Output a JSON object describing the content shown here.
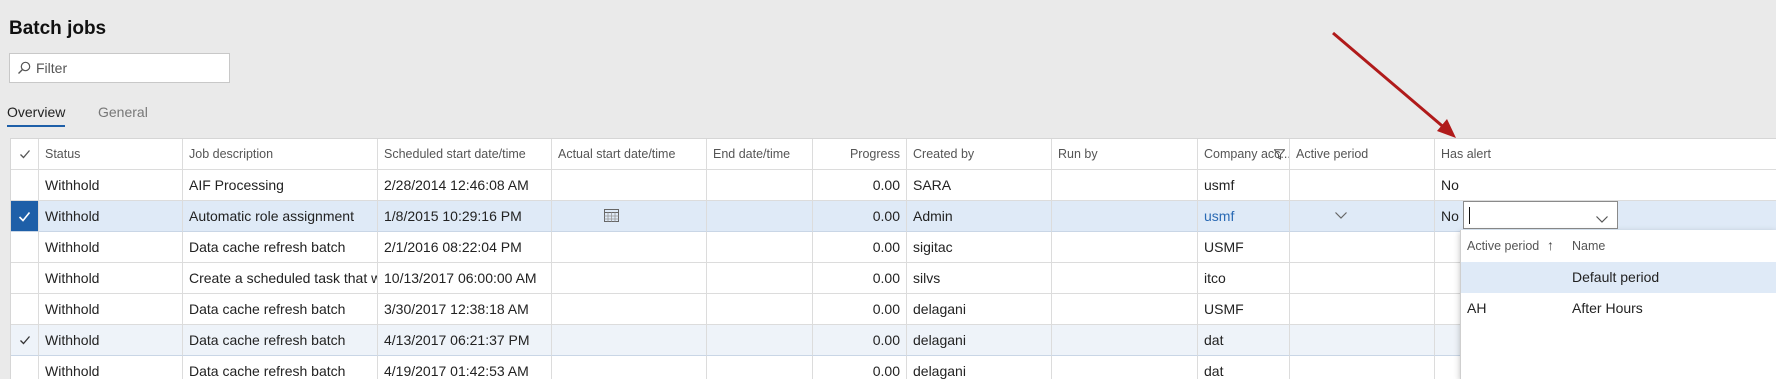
{
  "page": {
    "title": "Batch jobs"
  },
  "filter": {
    "placeholder": "Filter"
  },
  "tabs": [
    {
      "label": "Overview"
    },
    {
      "label": "General"
    }
  ],
  "grid": {
    "columns": [
      "Status",
      "Job description",
      "Scheduled start date/time",
      "Actual start date/time",
      "End date/time",
      "Progress",
      "Created by",
      "Run by",
      "Company acc...",
      "Active period",
      "Has alert"
    ],
    "rows": [
      {
        "status": "Withhold",
        "description": "AIF Processing",
        "scheduled": "2/28/2014 12:46:08 AM",
        "actual": "",
        "end": "",
        "progress": "0.00",
        "created_by": "SARA",
        "run_by": "",
        "company": "usmf",
        "active_period": "",
        "has_alert": "No"
      },
      {
        "status": "Withhold",
        "description": "Automatic role assignment",
        "scheduled": "1/8/2015 10:29:16 PM",
        "actual": "",
        "end": "",
        "progress": "0.00",
        "created_by": "Admin",
        "run_by": "",
        "company": "usmf",
        "active_period": "",
        "has_alert": "No"
      },
      {
        "status": "Withhold",
        "description": "Data cache refresh batch",
        "scheduled": "2/1/2016 08:22:04 PM",
        "actual": "",
        "end": "",
        "progress": "0.00",
        "created_by": "sigitac",
        "run_by": "",
        "company": "USMF",
        "active_period": "",
        "has_alert": ""
      },
      {
        "status": "Withhold",
        "description": "Create a scheduled task that will...",
        "scheduled": "10/13/2017 06:00:00 AM",
        "actual": "",
        "end": "",
        "progress": "0.00",
        "created_by": "silvs",
        "run_by": "",
        "company": "itco",
        "active_period": "",
        "has_alert": ""
      },
      {
        "status": "Withhold",
        "description": "Data cache refresh batch",
        "scheduled": "3/30/2017 12:38:18 AM",
        "actual": "",
        "end": "",
        "progress": "0.00",
        "created_by": "delagani",
        "run_by": "",
        "company": "USMF",
        "active_period": "",
        "has_alert": ""
      },
      {
        "status": "Withhold",
        "description": "Data cache refresh batch",
        "scheduled": "4/13/2017 06:21:37 PM",
        "actual": "",
        "end": "",
        "progress": "0.00",
        "created_by": "delagani",
        "run_by": "",
        "company": "dat",
        "active_period": "",
        "has_alert": ""
      },
      {
        "status": "Withhold",
        "description": "Data cache refresh batch",
        "scheduled": "4/19/2017 01:42:53 AM",
        "actual": "",
        "end": "",
        "progress": "0.00",
        "created_by": "delagani",
        "run_by": "",
        "company": "dat",
        "active_period": "",
        "has_alert": ""
      }
    ]
  },
  "lookup": {
    "columns": [
      "Active period",
      "Name"
    ],
    "rows": [
      {
        "period": "",
        "name": "Default period"
      },
      {
        "period": "AH",
        "name": "After Hours"
      }
    ]
  },
  "colors": {
    "accent": "#1e5fa8",
    "selected_row": "#dfeaf7",
    "annotation_arrow": "#b01a1a"
  },
  "icons": [
    "search-icon",
    "check-icon",
    "filter-icon",
    "calendar-icon",
    "chevron-down-icon",
    "sort-up-icon"
  ]
}
